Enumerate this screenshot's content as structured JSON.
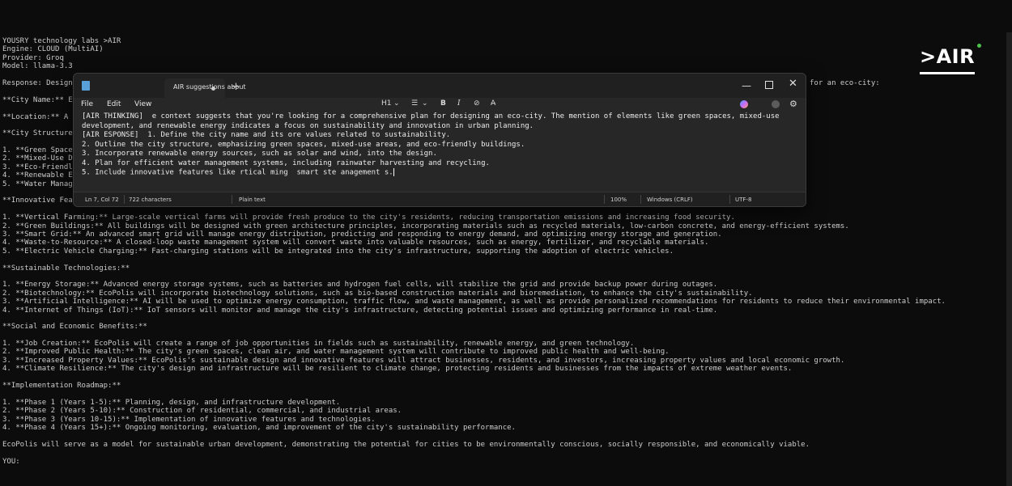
{
  "terminal": {
    "lines": [
      "YOUSRY technology labs >AIR",
      "Engine: CLOUD (MultiAI)",
      "Provider: Groq",
      "Model: llama-3.3",
      "",
      "Response: Designi                                                                                                                                                     omprehensive plan for an eco-city:",
      "",
      "**City Name:** Ec",
      "",
      "**Location:** A c",
      "",
      "**City Structure:",
      "",
      "1. **Green Spaces",
      "2. **Mixed-Use De                                                                                                                                               ion.",
      "3. **Eco-Friendly",
      "4. **Renewable En",
      "5. **Water Manage",
      "",
      "**Innovative Feat",
      "",
      "1. **Vertical Farming:** Large-scale vertical farms will provide fresh produce to the city's residents, reducing transportation emissions and increasing food security.",
      "2. **Green Buildings:** All buildings will be designed with green architecture principles, incorporating materials such as recycled materials, low-carbon concrete, and energy-efficient systems.",
      "3. **Smart Grid:** An advanced smart grid will manage energy distribution, predicting and responding to energy demand, and optimizing energy storage and generation.",
      "4. **Waste-to-Resource:** A closed-loop waste management system will convert waste into valuable resources, such as energy, fertilizer, and recyclable materials.",
      "5. **Electric Vehicle Charging:** Fast-charging stations will be integrated into the city's infrastructure, supporting the adoption of electric vehicles.",
      "",
      "**Sustainable Technologies:**",
      "",
      "1. **Energy Storage:** Advanced energy storage systems, such as batteries and hydrogen fuel cells, will stabilize the grid and provide backup power during outages.",
      "2. **Biotechnology:** EcoPolis will incorporate biotechnology solutions, such as bio-based construction materials and bioremediation, to enhance the city's sustainability.",
      "3. **Artificial Intelligence:** AI will be used to optimize energy consumption, traffic flow, and waste management, as well as provide personalized recommendations for residents to reduce their environmental impact.",
      "4. **Internet of Things (IoT):** IoT sensors will monitor and manage the city's infrastructure, detecting potential issues and optimizing performance in real-time.",
      "",
      "**Social and Economic Benefits:**",
      "",
      "1. **Job Creation:** EcoPolis will create a range of job opportunities in fields such as sustainability, renewable energy, and green technology.",
      "2. **Improved Public Health:** The city's green spaces, clean air, and water management system will contribute to improved public health and well-being.",
      "3. **Increased Property Values:** EcoPolis's sustainable design and innovative features will attract businesses, residents, and investors, increasing property values and local economic growth.",
      "4. **Climate Resilience:** The city's design and infrastructure will be resilient to climate change, protecting residents and businesses from the impacts of extreme weather events.",
      "",
      "**Implementation Roadmap:**",
      "",
      "1. **Phase 1 (Years 1-5):** Planning, design, and infrastructure development.",
      "2. **Phase 2 (Years 5-10):** Construction of residential, commercial, and industrial areas.",
      "3. **Phase 3 (Years 10-15):** Implementation of innovative features and technologies.",
      "4. **Phase 4 (Years 15+):** Ongoing monitoring, evaluation, and improvement of the city's sustainability performance.",
      "",
      "EcoPolis will serve as a model for sustainable urban development, demonstrating the potential for cities to be environmentally conscious, socially responsible, and economically viable.",
      "",
      "YOU:"
    ]
  },
  "logo": {
    "text": ">AIR",
    "dot_color": "#4cc24c"
  },
  "notepad": {
    "tab_title": "AIR suggestions about",
    "new_tab": "+",
    "window_controls": {
      "minimize": "—",
      "close": "✕"
    },
    "menu": {
      "file": "File",
      "edit": "Edit",
      "view": "View"
    },
    "toolbar": {
      "heading": "H1",
      "heading_chevron": "⌄",
      "list": "☰",
      "list_chevron": "⌄",
      "bold": "B",
      "italic": "I",
      "link": "⊘",
      "clear_format": "A̶"
    },
    "editor_lines": [
      "[AIR THINKING]  e context suggests that you're looking for a comprehensive plan for designing an eco-city. The mention of elements like green spaces, mixed-use",
      "development, and renewable energy indicates a focus on sustainability and innovation in urban planning.",
      "[AIR ESPONSE]  1. Define the city name and its ore values related to sustainability.",
      "2. Outline the city structure, emphasizing green spaces, mixed-use areas, and eco-friendly buildings.",
      "3. Incorporate renewable energy sources, such as solar and wind, into the design.",
      "4. Plan for efficient water management systems, including rainwater harvesting and recycling.",
      "5. Include innovative features like rtical ming  smart ste anagement s."
    ],
    "status": {
      "position": "Ln 7, Col 72",
      "characters": "722 characters",
      "format": "Plain text",
      "zoom": "100%",
      "line_endings": "Windows (CRLF)",
      "encoding": "UTF-8"
    }
  }
}
